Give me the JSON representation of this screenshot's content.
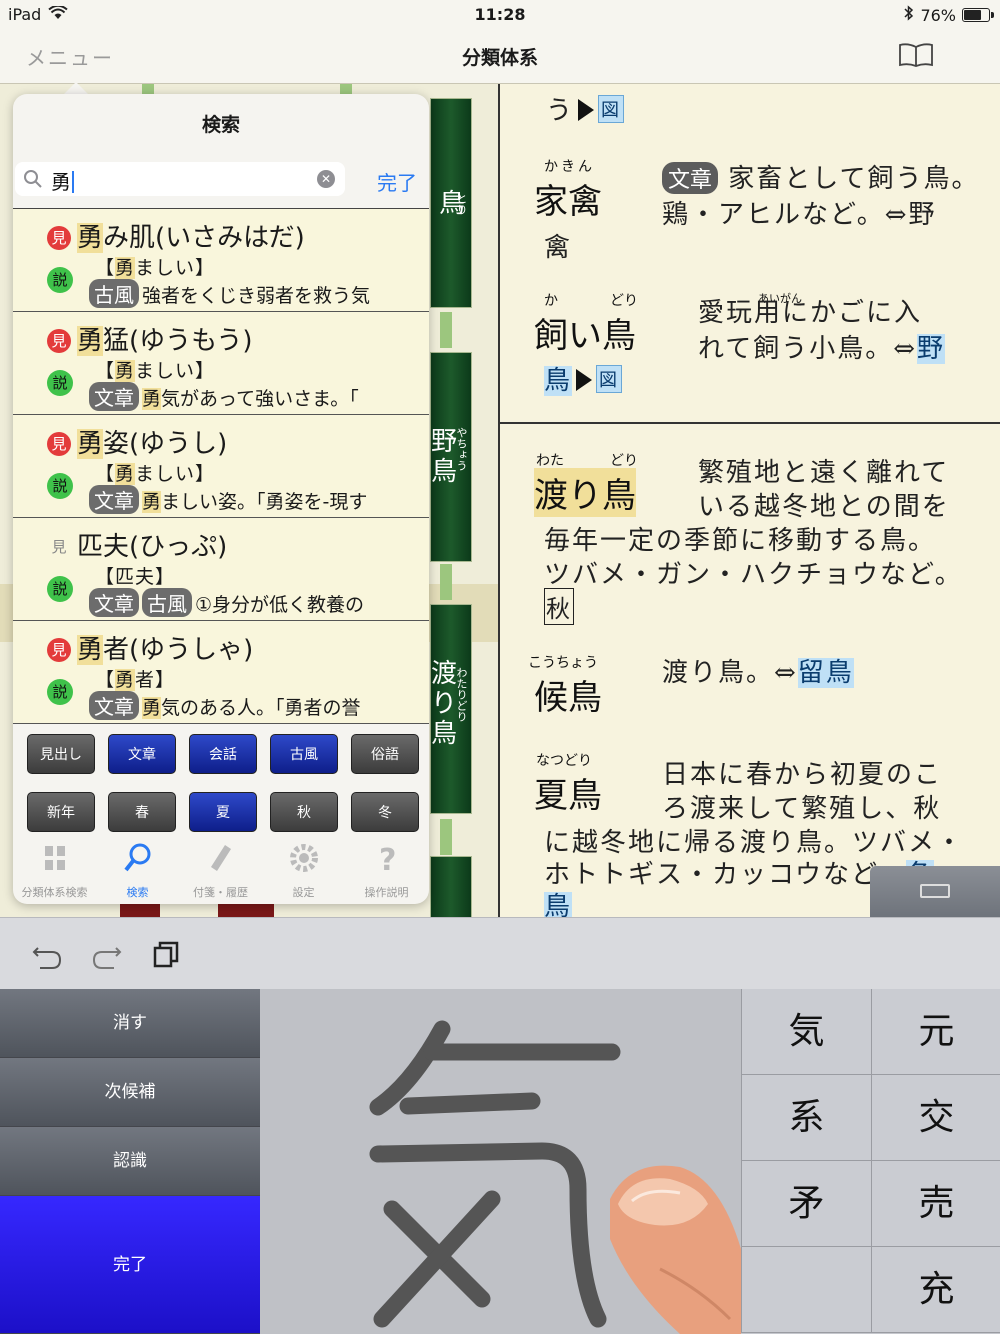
{
  "status": {
    "device": "iPad",
    "time": "11:28",
    "battery": "76%",
    "battery_level": 0.76
  },
  "nav": {
    "menu": "メニュー",
    "title": "分類体系"
  },
  "bg_tabs": [
    {
      "char": "鳥",
      "reading": "とり"
    },
    {
      "char": "野鳥",
      "reading": "やちょう"
    },
    {
      "char": "渡り鳥",
      "reading": "わたりどり"
    }
  ],
  "content": {
    "top_line": "う",
    "zu": "図",
    "e1": {
      "reading": "かきん",
      "word": "家禽",
      "alt": "禽",
      "tag": "文章",
      "def1": "家畜として飼う鳥。",
      "def2": "鶏・アヒルなど。⇔野"
    },
    "e2": {
      "reading1": "か",
      "reading2": "どり",
      "word": "飼い鳥",
      "ruby_aigan": "あいがん",
      "def1": "愛玩用にかごに入",
      "def2": "れて飼う小鳥。⇔",
      "link": "野",
      "link2": "鳥"
    },
    "e3": {
      "reading1": "わた",
      "reading2": "どり",
      "word": "渡り鳥",
      "def1": "繁殖地と遠く離れて",
      "def2": "いる越冬地との間を",
      "def3": "毎年一定の季節に移動する鳥。",
      "def4": "ツバメ・ガン・ハクチョウなど。",
      "season": "秋"
    },
    "e4": {
      "reading": "こうちょう",
      "word": "候鳥",
      "def1": "渡り鳥。⇔",
      "link": "留鳥"
    },
    "e5": {
      "reading": "なつどり",
      "word": "夏鳥",
      "def1": "日本に春から初夏のこ",
      "def2": "ろ渡来して繁殖し、秋",
      "def3": "に越冬地に帰る渡り鳥。ツバメ・",
      "def4": "ホトトギス・カッコウなど。",
      "link_a": "冬",
      "link_b": "鳥"
    }
  },
  "search": {
    "title": "検索",
    "query": "勇",
    "done": "完了",
    "results": [
      {
        "mi": "見",
        "head_hl": "勇",
        "head": "み肌(いさみはだ)",
        "se": "説",
        "sub_a": "【",
        "sub_hl": "勇",
        "sub_b": "ましい】",
        "pills": [
          "古風"
        ],
        "line_a": "強者をくじき弱者を救う気",
        "line_hl": "",
        "line_b": ""
      },
      {
        "mi": "見",
        "head_hl": "勇",
        "head": "猛(ゆうもう)",
        "se": "説",
        "sub_a": "【",
        "sub_hl": "勇",
        "sub_b": "ましい】",
        "pills": [
          "文章"
        ],
        "line_a": "",
        "line_hl": "勇",
        "line_b": "気があって強いさま。「"
      },
      {
        "mi": "見",
        "head_hl": "勇",
        "head": "姿(ゆうし)",
        "se": "説",
        "sub_a": "【",
        "sub_hl": "勇",
        "sub_b": "ましい】",
        "pills": [
          "文章"
        ],
        "line_a": "",
        "line_hl": "勇",
        "line_b": "ましい姿。「勇姿を-現す"
      },
      {
        "mi": "見",
        "head_hl": "",
        "head": "匹夫(ひっぷ)",
        "se": "説",
        "sub_a": "【匹夫】",
        "sub_hl": "",
        "sub_b": "",
        "pills": [
          "文章",
          "古風"
        ],
        "line_a": "①身分が低く教養の",
        "line_hl": "",
        "line_b": ""
      },
      {
        "mi": "見",
        "head_hl": "勇",
        "head": "者(ゆうしゃ)",
        "se": "説",
        "sub_a": "【",
        "sub_hl": "勇",
        "sub_b": "者】",
        "pills": [
          "文章"
        ],
        "line_a": "",
        "line_hl": "勇",
        "line_b": "気のある人。「勇者の誉"
      }
    ],
    "categories_row1": [
      "見出し",
      "文章",
      "会話",
      "古風",
      "俗語"
    ],
    "categories_row2": [
      "新年",
      "春",
      "夏",
      "秋",
      "冬"
    ],
    "tabs": [
      "分類体系検索",
      "検索",
      "付箋・履歴",
      "設定",
      "操作説明"
    ]
  },
  "hw": {
    "buttons": [
      "消す",
      "次候補",
      "認識",
      "完了"
    ],
    "candidates": [
      "気",
      "元",
      "系",
      "交",
      "矛",
      "売",
      "",
      "充"
    ]
  }
}
